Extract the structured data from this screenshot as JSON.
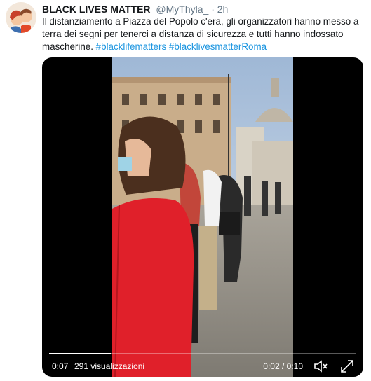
{
  "tweet": {
    "display_name": "BLACK LIVES MATTER",
    "handle": "@MyThyla_",
    "separator": "·",
    "time": "2h",
    "text": "Il distanziamento a Piazza del Popolo c'era, gli organizzatori hanno messo a terra dei segni per tenerci a distanza di sicurezza e tutti hanno indossato mascherine.",
    "hashtags": [
      "#blacklifematters",
      "#blacklivesmatterRoma"
    ]
  },
  "video": {
    "elapsed": "0:07",
    "views": "291 visualizzazioni",
    "position_duration": "0:02 / 0:10",
    "progress": 0.2,
    "icons": [
      "mute-icon",
      "fullscreen-icon"
    ]
  },
  "colors": {
    "link": "#1b95e0",
    "secondary_text": "#657786",
    "video_background": "#000000"
  }
}
